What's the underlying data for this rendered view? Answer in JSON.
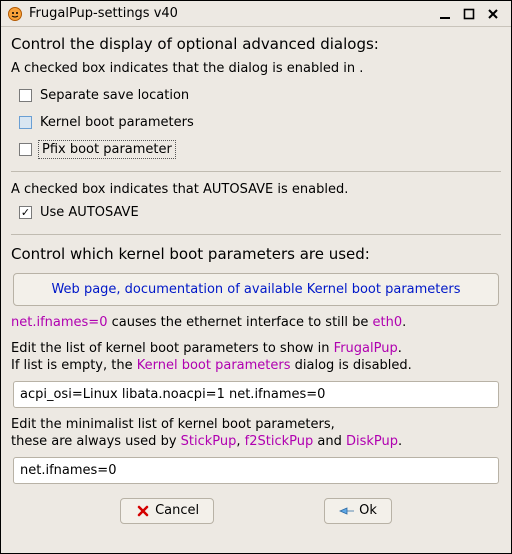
{
  "window": {
    "title": "FrugalPup-settings v40"
  },
  "section1": {
    "heading": "Control the display of optional advanced dialogs:",
    "intro": "A checked box indicates that the dialog is enabled in .",
    "checks": {
      "separate_save": {
        "label": "Separate save location",
        "checked": false
      },
      "kernel_params": {
        "label": "Kernel boot parameters",
        "checked": false
      },
      "pfix": {
        "label": "Pfix boot parameter",
        "checked": false
      }
    }
  },
  "section2": {
    "intro": "A checked box indicates that AUTOSAVE is enabled.",
    "autosave": {
      "label": "Use AUTOSAVE",
      "checked": true
    }
  },
  "section3": {
    "heading": "Control which kernel boot parameters are used:",
    "link_label": "Web page, documentation of available Kernel boot parameters",
    "net_line_pre": "net.ifnames=0",
    "net_line_mid": " causes the ethernet interface to still be ",
    "net_line_post": "eth0",
    "net_line_end": ".",
    "edit1_a": "Edit the list of kernel boot parameters to show in ",
    "edit1_app": "FrugalPup",
    "edit1_b": ".",
    "edit1_c": "If list is empty, the ",
    "edit1_d": "Kernel boot parameters",
    "edit1_e": " dialog is disabled.",
    "field1_value": "acpi_osi=Linux libata.noacpi=1 net.ifnames=0",
    "edit2_a": "Edit the minimalist list of kernel boot parameters,",
    "edit2_b": "these are always used by ",
    "edit2_app1": "StickPup",
    "edit2_sep1": ", ",
    "edit2_app2": "f2StickPup",
    "edit2_sep2": " and ",
    "edit2_app3": "DiskPup",
    "edit2_end": ".",
    "field2_value": "net.ifnames=0"
  },
  "buttons": {
    "cancel": "Cancel",
    "ok": "Ok"
  }
}
